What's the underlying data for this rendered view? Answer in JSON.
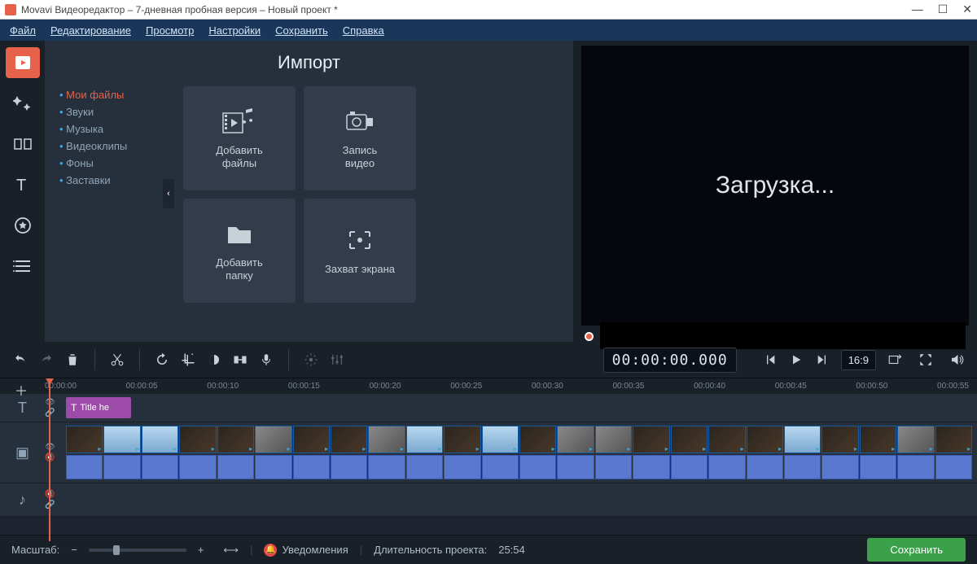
{
  "window": {
    "title": "Movavi Видеоредактор – 7-дневная пробная версия – Новый проект *",
    "minimize": "—",
    "maximize": "☐",
    "close": "✕"
  },
  "menu": {
    "file": "Файл",
    "edit": "Редактирование",
    "view": "Просмотр",
    "settings": "Настройки",
    "save": "Сохранить",
    "help": "Справка"
  },
  "import": {
    "heading": "Импорт",
    "categories": {
      "myfiles": "Мои файлы",
      "sounds": "Звуки",
      "music": "Музыка",
      "videoclips": "Видеоклипы",
      "backgrounds": "Фоны",
      "intros": "Заставки"
    },
    "tiles": {
      "addfiles": "Добавить\nфайлы",
      "recordvideo": "Запись\nвидео",
      "addfolder": "Добавить\nпапку",
      "screencap": "Захват экрана"
    }
  },
  "preview": {
    "loading": "Загрузка..."
  },
  "playback": {
    "timecode": "00:00:00.000",
    "ratio": "16:9"
  },
  "ruler": {
    "ticks": [
      "00:00:00",
      "00:00:05",
      "00:00:10",
      "00:00:15",
      "00:00:20",
      "00:00:25",
      "00:00:30",
      "00:00:35",
      "00:00:40",
      "00:00:45",
      "00:00:50",
      "00:00:55"
    ]
  },
  "tracks": {
    "titleclip": "Title he"
  },
  "status": {
    "zoom_label": "Масштаб:",
    "notifications": "Уведомления",
    "duration_label": "Длительность проекта:",
    "duration_value": "25:54",
    "save": "Сохранить"
  }
}
